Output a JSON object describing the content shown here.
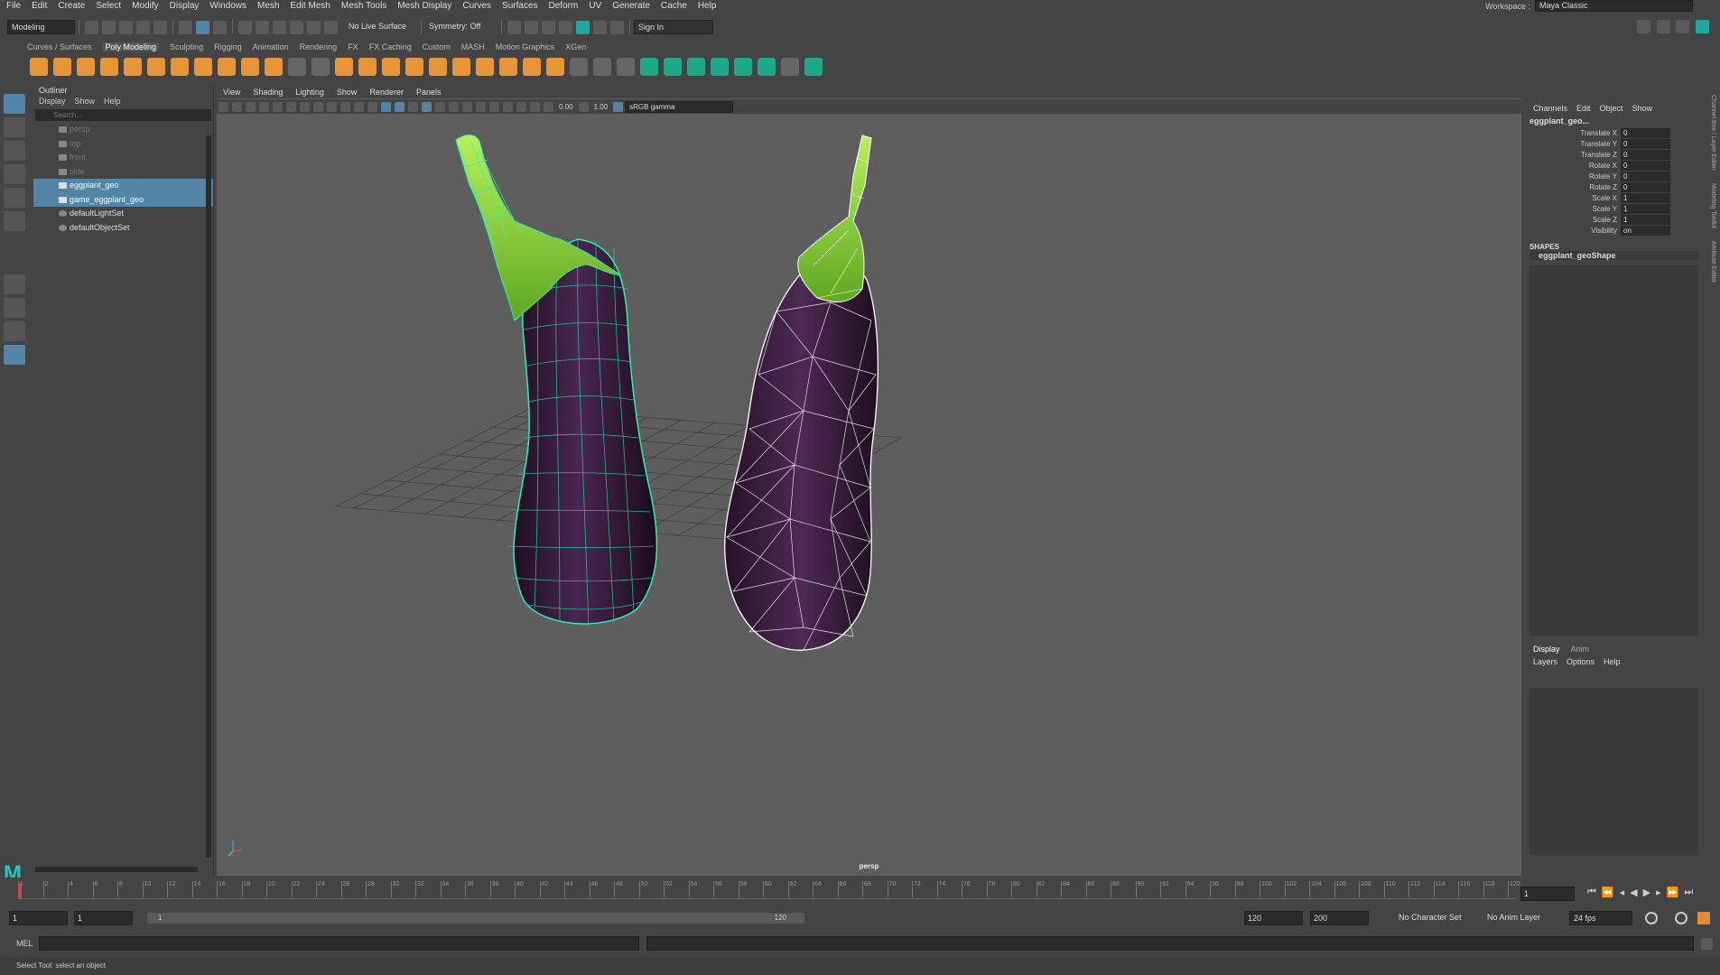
{
  "menubar": {
    "items": [
      "File",
      "Edit",
      "Create",
      "Select",
      "Modify",
      "Display",
      "Windows",
      "Mesh",
      "Edit Mesh",
      "Mesh Tools",
      "Mesh Display",
      "Curves",
      "Surfaces",
      "Deform",
      "UV",
      "Generate",
      "Cache",
      "Help"
    ],
    "workspace_label": "Workspace :",
    "workspace_value": "Maya Classic"
  },
  "statusline": {
    "mode": "Modeling",
    "live_surface": "No Live Surface",
    "symmetry": "Symmetry: Off",
    "sign_in": "Sign In"
  },
  "shelf": {
    "tabs": [
      "Curves / Surfaces",
      "Poly Modeling",
      "Sculpting",
      "Rigging",
      "Animation",
      "Rendering",
      "FX",
      "FX Caching",
      "Custom",
      "MASH",
      "Motion Graphics",
      "XGen"
    ],
    "active_tab": "Poly Modeling"
  },
  "outliner": {
    "title": "Outliner",
    "menu": [
      "Display",
      "Show",
      "Help"
    ],
    "search_placeholder": "Search...",
    "items": [
      {
        "label": "persp",
        "state": "dim",
        "icon": "camera-icon"
      },
      {
        "label": "top",
        "state": "dim",
        "icon": "camera-icon"
      },
      {
        "label": "front",
        "state": "dim",
        "icon": "camera-icon"
      },
      {
        "label": "side",
        "state": "dim",
        "icon": "camera-icon"
      },
      {
        "label": "eggplant_geo",
        "state": "selected",
        "icon": "mesh-icon"
      },
      {
        "label": "game_eggplant_geo",
        "state": "selected",
        "icon": "mesh-icon"
      },
      {
        "label": "defaultLightSet",
        "state": "normal",
        "icon": "set-icon"
      },
      {
        "label": "defaultObjectSet",
        "state": "normal",
        "icon": "set-icon"
      }
    ]
  },
  "viewport": {
    "menu": [
      "View",
      "Shading",
      "Lighting",
      "Show",
      "Renderer",
      "Panels"
    ],
    "exposure": "0.00",
    "gamma": "1.00",
    "color_space": "sRGB gamma",
    "camera_label": "persp"
  },
  "channelbox": {
    "menu": [
      "Channels",
      "Edit",
      "Object",
      "Show"
    ],
    "object_name": "eggplant_geo...",
    "channels": [
      {
        "label": "Translate X",
        "value": "0"
      },
      {
        "label": "Translate Y",
        "value": "0"
      },
      {
        "label": "Translate Z",
        "value": "0"
      },
      {
        "label": "Rotate X",
        "value": "0"
      },
      {
        "label": "Rotate Y",
        "value": "0"
      },
      {
        "label": "Rotate Z",
        "value": "0"
      },
      {
        "label": "Scale X",
        "value": "1"
      },
      {
        "label": "Scale Y",
        "value": "1"
      },
      {
        "label": "Scale Z",
        "value": "1"
      },
      {
        "label": "Visibility",
        "value": "on"
      }
    ],
    "shapes_header": "SHAPES",
    "shape_name": "eggplant_geoShape",
    "side_tabs": [
      "Channel Box / Layer Editor",
      "Modeling Toolkit",
      "Attribute Editor"
    ],
    "layer_tabs": [
      "Display",
      "Anim"
    ],
    "layer_menu": [
      "Layers",
      "Options",
      "Help"
    ]
  },
  "timeline": {
    "ticks": [
      "1",
      "2",
      "4",
      "6",
      "8",
      "10",
      "12",
      "14",
      "16",
      "18",
      "20",
      "22",
      "24",
      "26",
      "28",
      "30",
      "32",
      "34",
      "36",
      "38",
      "40",
      "42",
      "44",
      "46",
      "48",
      "50",
      "52",
      "54",
      "56",
      "58",
      "60",
      "62",
      "64",
      "66",
      "68",
      "70",
      "72",
      "74",
      "76",
      "78",
      "80",
      "82",
      "84",
      "86",
      "88",
      "90",
      "92",
      "94",
      "96",
      "98",
      "100",
      "102",
      "104",
      "106",
      "108",
      "110",
      "112",
      "114",
      "116",
      "118",
      "120"
    ],
    "current_frame": "1"
  },
  "range": {
    "start": "1",
    "playback_start": "1",
    "slider_start": "1",
    "slider_end": "120",
    "playback_end": "120",
    "end": "200",
    "character_set": "No Character Set",
    "anim_layer": "No Anim Layer",
    "fps": "24 fps"
  },
  "cmdline": {
    "label": "MEL"
  },
  "helpline": {
    "text": "Select Tool: select an object"
  },
  "colors": {
    "selection": "#5285a6",
    "accent": "#1fc8a0",
    "wire_left": "#2ef0b0",
    "wire_right": "#ffffff",
    "eggplant": "#3b1f3c",
    "calyx": "#8fd93a"
  }
}
